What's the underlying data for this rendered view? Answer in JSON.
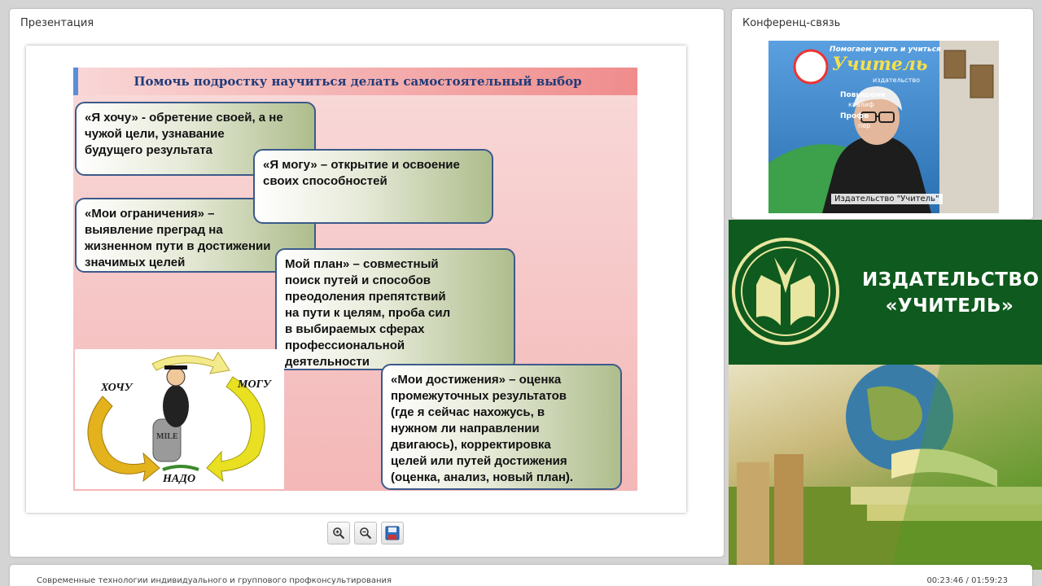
{
  "presentation": {
    "panel_title": "Презентация",
    "slide": {
      "title": "Помочь подростку научиться делать самостоятельный выбор",
      "boxes": [
        "«Я хочу» - обретение своей, а не\nчужой цели, узнавание\nбудущего результата",
        "«Я могу» – открытие и освоение\nсвоих способностей",
        "«Мои ограничения» –\nвыявление преград на\nжизненном пути в достижении\nзначимых целей",
        "Мой план» – совместный\nпоиск путей и способов\nпреодоления препятствий\nна пути к целям, проба сил\nв выбираемых сферах\nпрофессиональной\nдеятельности",
        "«Мои достижения» – оценка\nпромежуточных результатов\n(где я сейчас нахожусь, в\nнужном ли направлении\nдвигаюсь), корректировка\nцелей или путей достижения\n(оценка, анализ, новый план)."
      ],
      "cycle_labels": {
        "want": "ХОЧУ",
        "can": "МОГУ",
        "must": "НАДО",
        "stone": "MILE"
      }
    },
    "toolbar": {
      "zoom_in_icon": "zoom-in-icon",
      "zoom_out_icon": "zoom-out-icon",
      "save_icon": "floppy-disk-icon"
    }
  },
  "conference": {
    "panel_title": "Конференц-связь",
    "video_caption": "Издательство \"Учитель\"",
    "banner_line1": "Помогаем учить и учиться",
    "banner_line2": "Учитель",
    "banner_line3": "издательство",
    "banner_item1": "Повышени",
    "banner_item1b": "квалиф",
    "banner_item2": "Профе",
    "banner_item2b": "пер"
  },
  "brand": {
    "name_line1": "ИЗДАТЕЛЬСТВО",
    "name_line2": "«УЧИТЕЛЬ»"
  },
  "footer": {
    "course_title": "Современные технологии индивидуального и группового профконсультирования",
    "time": "00:23:46 / 01:59:23"
  },
  "colors": {
    "brand_green": "#0f5a1e",
    "slide_title": "#1f3b7a",
    "box_border": "#3b5a8a"
  }
}
